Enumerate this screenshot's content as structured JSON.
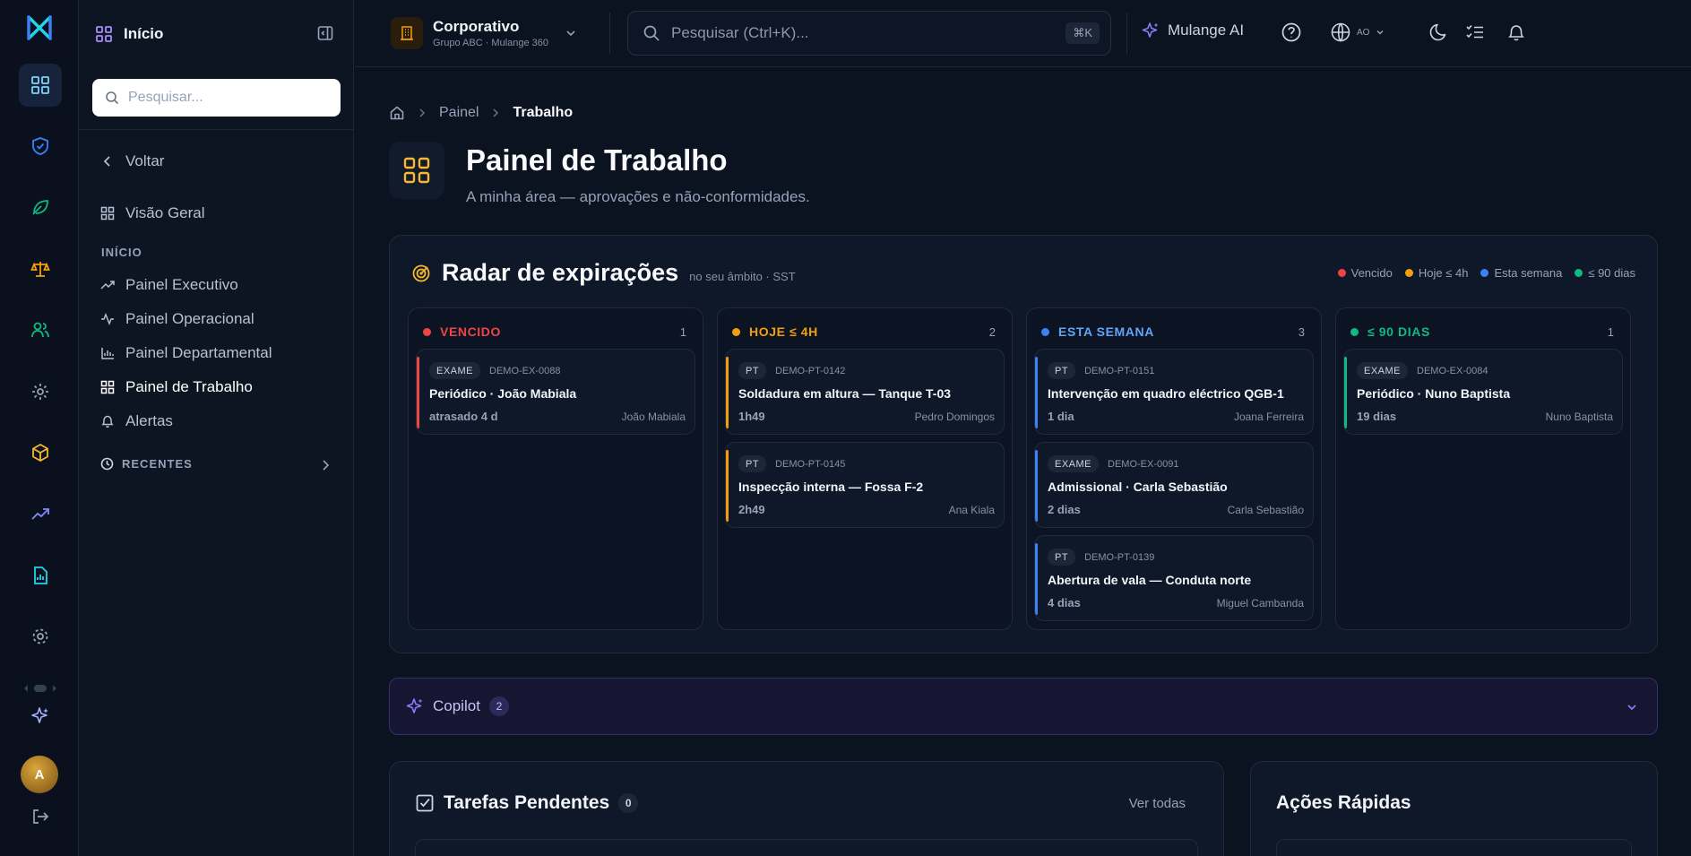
{
  "colors": {
    "accent_yellow": "#f5b82e",
    "overdue": "#ef4444",
    "today": "#f59e0b",
    "week": "#3b82f6",
    "ninety": "#10b981",
    "ai": "#8b7cf6"
  },
  "rail": {
    "icons": [
      "grid-icon",
      "shield-check-icon",
      "leaf-icon",
      "scale-icon",
      "users-icon",
      "settings-icon",
      "cube-icon",
      "trend-up-icon",
      "report-icon",
      "gear-icon",
      "sparkle-icon",
      "logout-icon"
    ],
    "avatar_initial": "A"
  },
  "sidebar": {
    "title": "Início",
    "search_placeholder": "Pesquisar...",
    "back_label": "Voltar",
    "overview_label": "Visão Geral",
    "section_label": "INÍCIO",
    "items": [
      {
        "label": "Painel Executivo"
      },
      {
        "label": "Painel Operacional"
      },
      {
        "label": "Painel Departamental"
      },
      {
        "label": "Painel de Trabalho"
      },
      {
        "label": "Alertas"
      }
    ],
    "recent_label": "RECENTES"
  },
  "topbar": {
    "org_name": "Corporativo",
    "org_sub": "Grupo ABC · Mulange 360",
    "search_placeholder": "Pesquisar (Ctrl+K)...",
    "shortcut": "⌘K",
    "ai_label": "Mulange AI",
    "lang_code": "AO"
  },
  "breadcrumb": {
    "items": [
      "Painel",
      "Trabalho"
    ]
  },
  "page": {
    "title": "Painel de Trabalho",
    "subtitle": "A minha área — aprovações e não-conformidades."
  },
  "radar": {
    "title": "Radar de expirações",
    "subtitle": "no seu âmbito · SST",
    "legend": [
      "Vencido",
      "Hoje ≤ 4h",
      "Esta semana",
      "≤ 90 dias"
    ],
    "columns": [
      {
        "label": "VENCIDO",
        "count": "1",
        "cards": [
          {
            "type": "EXAME",
            "code": "DEMO-EX-0088",
            "title": "Periódico · João Mabiala",
            "due": "atrasado 4 d",
            "person": "João Mabiala"
          }
        ]
      },
      {
        "label": "HOJE ≤ 4H",
        "count": "2",
        "cards": [
          {
            "type": "PT",
            "code": "DEMO-PT-0142",
            "title": "Soldadura em altura — Tanque T-03",
            "due": "1h49",
            "person": "Pedro Domingos"
          },
          {
            "type": "PT",
            "code": "DEMO-PT-0145",
            "title": "Inspecção interna — Fossa F-2",
            "due": "2h49",
            "person": "Ana Kiala"
          }
        ]
      },
      {
        "label": "ESTA SEMANA",
        "count": "3",
        "cards": [
          {
            "type": "PT",
            "code": "DEMO-PT-0151",
            "title": "Intervenção em quadro eléctrico QGB-1",
            "due": "1 dia",
            "person": "Joana Ferreira"
          },
          {
            "type": "EXAME",
            "code": "DEMO-EX-0091",
            "title": "Admissional · Carla Sebastião",
            "due": "2 dias",
            "person": "Carla Sebastião"
          },
          {
            "type": "PT",
            "code": "DEMO-PT-0139",
            "title": "Abertura de vala — Conduta norte",
            "due": "4 dias",
            "person": "Miguel Cambanda"
          }
        ]
      },
      {
        "label": "≤ 90 DIAS",
        "count": "1",
        "cards": [
          {
            "type": "EXAME",
            "code": "DEMO-EX-0084",
            "title": "Periódico · Nuno Baptista",
            "due": "19 dias",
            "person": "Nuno Baptista"
          }
        ]
      }
    ]
  },
  "copilot": {
    "label": "Copilot",
    "count": "2"
  },
  "tasks": {
    "title": "Tarefas Pendentes",
    "count": "0",
    "link": "Ver todas"
  },
  "quick_actions": {
    "title": "Ações Rápidas"
  }
}
